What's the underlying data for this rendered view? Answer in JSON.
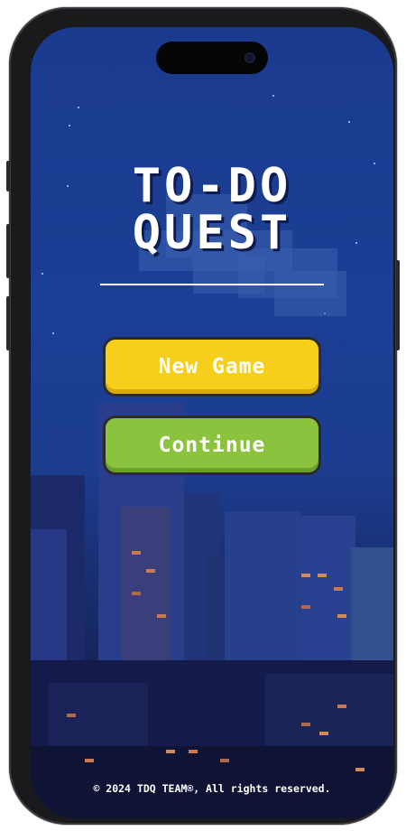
{
  "title": {
    "line1": "TO-DO",
    "line2": "QUEST"
  },
  "menu": {
    "new_game_label": "New Game",
    "continue_label": "Continue"
  },
  "footer": {
    "copyright": "© 2024 TDQ TEAM®, All rights reserved."
  },
  "colors": {
    "sky": "#1b3f95",
    "new_game_button": "#f6cf1d",
    "continue_button": "#8bc33f",
    "title_text": "#ffffff"
  }
}
